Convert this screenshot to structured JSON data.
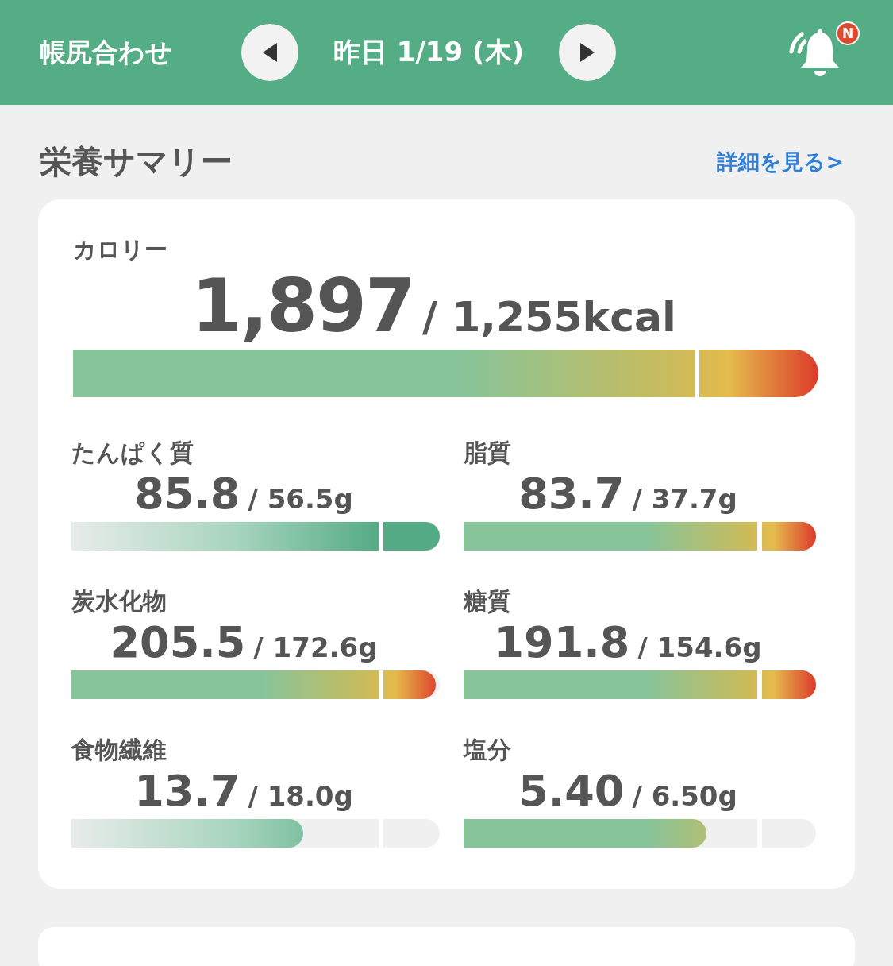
{
  "header": {
    "title": "帳尻合わせ",
    "date": "昨日 1/19 (木)",
    "badge": "N"
  },
  "summary": {
    "title": "栄養サマリー",
    "link": "詳細を見る>"
  },
  "calorie": {
    "label": "カロリー",
    "value": "1,897",
    "target": "/ 1,255kcal",
    "kind": "limit",
    "level": 1
  },
  "nutrients": [
    {
      "label": "たんぱく質",
      "value": "85.8",
      "target": "/ 56.5g",
      "kind": "goal",
      "level": 1
    },
    {
      "label": "脂質",
      "value": "83.7",
      "target": "/ 37.7g",
      "kind": "limit",
      "level": 1
    },
    {
      "label": "炭水化物",
      "value": "205.5",
      "target": "/ 172.6g",
      "kind": "limit",
      "level": 0.99
    },
    {
      "label": "糖質",
      "value": "191.8",
      "target": "/ 154.6g",
      "kind": "limit",
      "level": 1
    },
    {
      "label": "食物繊維",
      "value": "13.7",
      "target": "/ 18.0g",
      "kind": "goal",
      "level": 0.63
    },
    {
      "label": "塩分",
      "value": "5.40",
      "target": "/ 6.50g",
      "kind": "limit",
      "level": 0.69
    }
  ]
}
